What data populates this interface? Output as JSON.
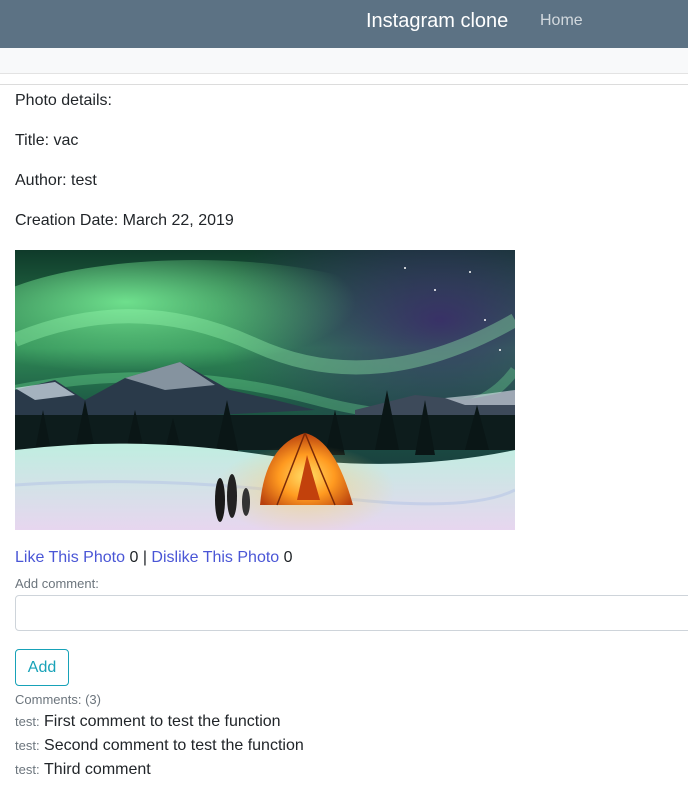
{
  "navbar": {
    "brand": "Instagram clone",
    "home_label": "Home",
    "background": "#5c7284"
  },
  "details": {
    "heading": "Photo details:",
    "title": "Title: vac",
    "author": "Author: test",
    "creation_date": "Creation Date: March 22, 2019"
  },
  "photo": {
    "description_icon": "aurora-camping-photo"
  },
  "votes": {
    "like_label": "Like This Photo",
    "like_count": "0",
    "separator": "|",
    "dislike_label": "Dislike This Photo",
    "dislike_count": "0",
    "link_color": "#4a56d6"
  },
  "comment_form": {
    "label": "Add comment:",
    "value": "",
    "placeholder": "",
    "submit_label": "Add",
    "accent": "#17a2b8"
  },
  "comments": {
    "header": "Comments: (3)",
    "items": [
      {
        "author": "test:",
        "text": "First comment to test the function"
      },
      {
        "author": "test:",
        "text": "Second comment to test the function"
      },
      {
        "author": "test:",
        "text": "Third comment"
      }
    ]
  }
}
